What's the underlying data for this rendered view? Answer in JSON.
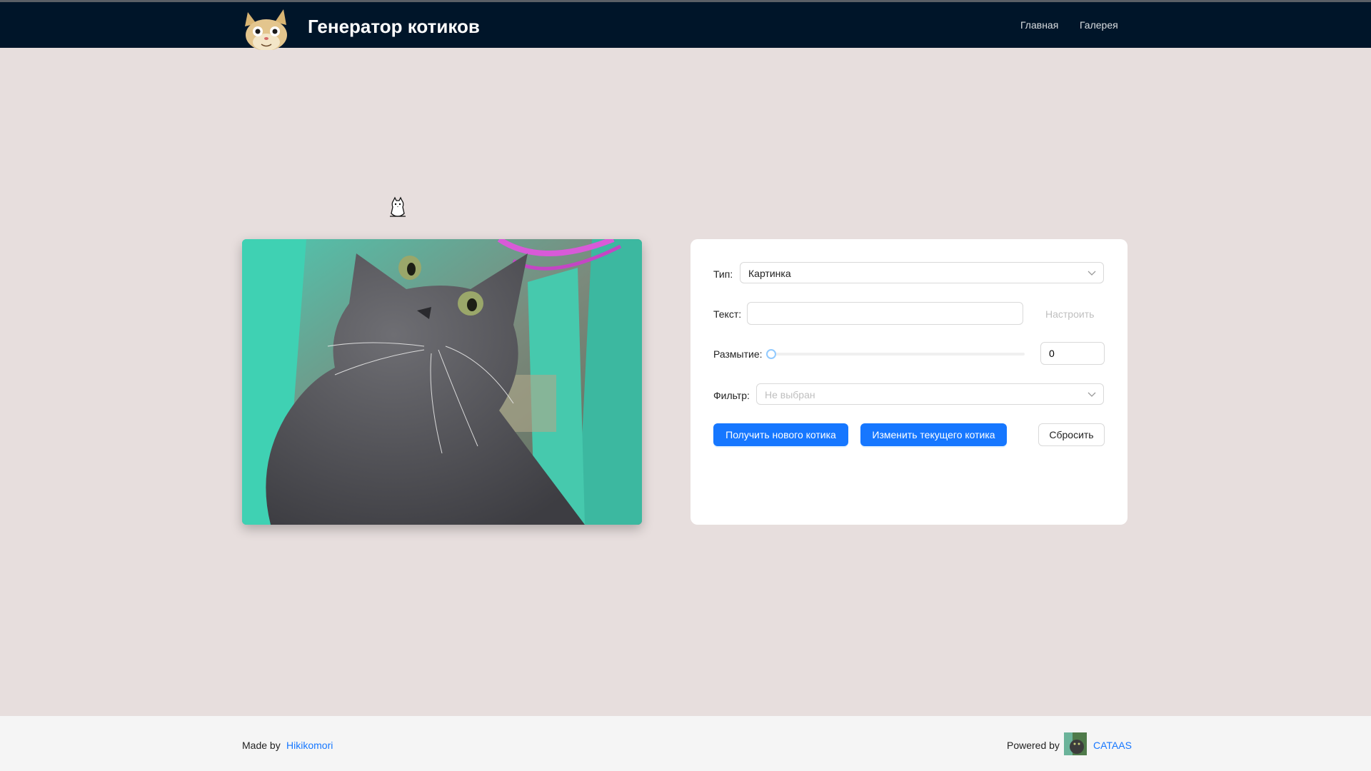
{
  "header": {
    "title": "Генератор котиков",
    "logo_icon": "cat-face-logo-icon",
    "nav": {
      "home": "Главная",
      "gallery": "Галерея"
    }
  },
  "form": {
    "type_label": "Тип:",
    "type_value": "Картинка",
    "text_label": "Текст:",
    "text_value": "",
    "configure_link": "Настроить",
    "blur_label": "Размытие:",
    "blur_value": "0",
    "blur_level": 0,
    "filter_label": "Фильтр:",
    "filter_placeholder": "Не выбран",
    "buttons": {
      "new_cat": "Получить нового котика",
      "edit_cat": "Изменить текущего котика",
      "reset": "Сбросить"
    }
  },
  "footer": {
    "made_by_label": "Made by",
    "made_by_link": "Hikikomori",
    "powered_by_label": "Powered by",
    "powered_by_link": "CATAAS"
  },
  "colors": {
    "header_bg": "#001529",
    "page_bg": "#e7dedd",
    "primary": "#1677ff",
    "footer_bg": "#f5f5f5"
  }
}
